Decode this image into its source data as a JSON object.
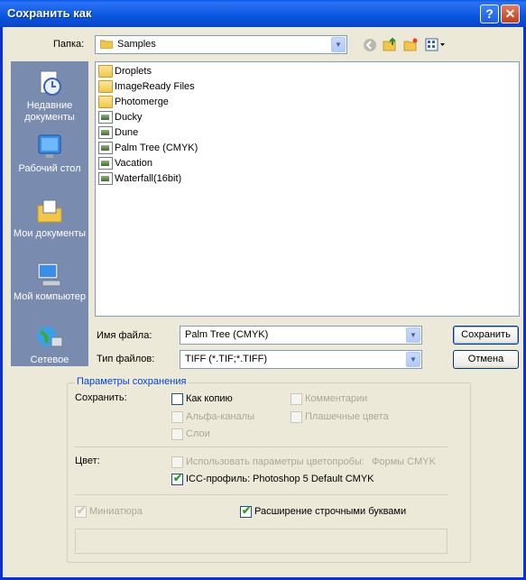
{
  "window": {
    "title": "Сохранить как",
    "help_glyph": "?",
    "close_glyph": "✕"
  },
  "toolbar": {
    "folder_label": "Папка:",
    "folder_value": "Samples"
  },
  "places": [
    {
      "name": "places-recent",
      "label": "Недавние документы",
      "icon": "recent-documents-icon"
    },
    {
      "name": "places-desktop",
      "label": "Рабочий стол",
      "icon": "desktop-icon"
    },
    {
      "name": "places-mydocs",
      "label": "Мои документы",
      "icon": "my-documents-icon"
    },
    {
      "name": "places-computer",
      "label": "Мой компьютер",
      "icon": "my-computer-icon"
    },
    {
      "name": "places-network",
      "label": "Сетевое",
      "icon": "network-icon"
    }
  ],
  "files": [
    {
      "name": "Droplets",
      "type": "folder"
    },
    {
      "name": "ImageReady Files",
      "type": "folder"
    },
    {
      "name": "Photomerge",
      "type": "folder"
    },
    {
      "name": "Ducky",
      "type": "image"
    },
    {
      "name": "Dune",
      "type": "image"
    },
    {
      "name": "Palm Tree (CMYK)",
      "type": "image"
    },
    {
      "name": "Vacation",
      "type": "image"
    },
    {
      "name": "Waterfall(16bit)",
      "type": "image"
    }
  ],
  "form": {
    "filename_label": "Имя файла:",
    "filename_value": "Palm Tree (CMYK)",
    "filetype_label": "Тип файлов:",
    "filetype_value": "TIFF (*.TIF;*.TIFF)",
    "save_button": "Сохранить",
    "cancel_button": "Отмена"
  },
  "options": {
    "group_title": "Параметры сохранения",
    "save_label": "Сохранить:",
    "as_copy": "Как копию",
    "alpha": "Альфа-каналы",
    "layers": "Слои",
    "comments": "Комментарии",
    "spot": "Плашечные цвета",
    "color_label": "Цвет:",
    "proof": "Использовать параметры цветопробы:",
    "proof_value": "Формы CMYK",
    "icc": "ICC-профиль:",
    "icc_value": "Photoshop 5 Default CMYK",
    "thumbnail": "Миниатюра",
    "lowercase": "Расширение строчными буквами"
  },
  "check_glyph": "✔",
  "colors": {
    "title_bar": "#0a56e0",
    "dialog_bg": "#ece9d8",
    "places_bg": "#7a8bb0",
    "group_title": "#0046d5"
  }
}
